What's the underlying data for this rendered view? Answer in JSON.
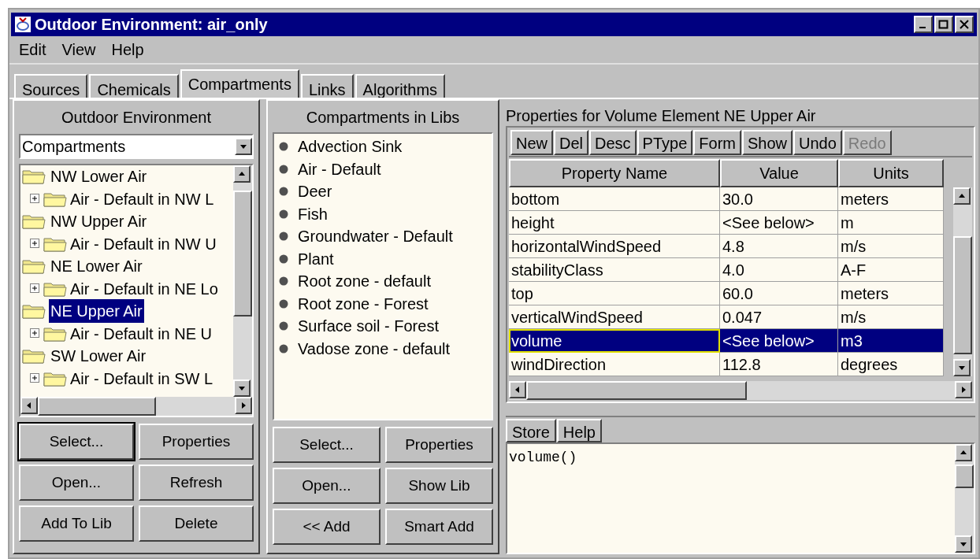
{
  "window": {
    "title": "Outdoor Environment: air_only"
  },
  "menu": [
    "Edit",
    "View",
    "Help"
  ],
  "tabs": [
    {
      "label": "Sources",
      "selected": false
    },
    {
      "label": "Chemicals",
      "selected": false
    },
    {
      "label": "Compartments",
      "selected": true
    },
    {
      "label": "Links",
      "selected": false
    },
    {
      "label": "Algorithms",
      "selected": false
    }
  ],
  "left_panel": {
    "title": "Outdoor Environment",
    "dropdown": {
      "value": "Compartments"
    },
    "tree": [
      {
        "label": "NW Lower Air",
        "selected": false,
        "children": [
          {
            "label": "Air - Default in NW L",
            "selected": false
          }
        ]
      },
      {
        "label": "NW Upper Air",
        "selected": false,
        "children": [
          {
            "label": "Air - Default in NW U",
            "selected": false
          }
        ]
      },
      {
        "label": "NE Lower Air",
        "selected": false,
        "children": [
          {
            "label": "Air - Default in NE Lo",
            "selected": false
          }
        ]
      },
      {
        "label": "NE Upper Air",
        "selected": true,
        "children": [
          {
            "label": "Air - Default in NE U",
            "selected": false
          }
        ]
      },
      {
        "label": "SW Lower Air",
        "selected": false,
        "children": [
          {
            "label": "Air - Default in SW L",
            "selected": false
          }
        ]
      }
    ],
    "buttons": [
      {
        "label": "Select...",
        "default": true
      },
      {
        "label": "Properties",
        "default": false
      },
      {
        "label": "Open...",
        "default": false
      },
      {
        "label": "Refresh",
        "default": false
      },
      {
        "label": "Add To Lib",
        "default": false
      },
      {
        "label": "Delete",
        "default": false
      }
    ]
  },
  "middle_panel": {
    "title": "Compartments in Libs",
    "items": [
      "Advection Sink",
      "Air - Default",
      "Deer",
      "Fish",
      "Groundwater - Default",
      "Plant",
      "Root zone - default",
      "Root zone - Forest",
      "Surface soil - Forest",
      "Vadose zone - default"
    ],
    "buttons": [
      "Select...",
      "Properties",
      "Open...",
      "Show Lib",
      "<< Add",
      "Smart Add"
    ]
  },
  "right_panel": {
    "title": "Properties for Volume Element NE Upper Air",
    "toolbar": [
      {
        "label": "New",
        "disabled": false
      },
      {
        "label": "Del",
        "disabled": false
      },
      {
        "label": "Desc",
        "disabled": false
      },
      {
        "label": "PType",
        "disabled": false
      },
      {
        "label": "Form",
        "disabled": false
      },
      {
        "label": "Show",
        "disabled": false
      },
      {
        "label": "Undo",
        "disabled": false
      },
      {
        "label": "Redo",
        "disabled": true
      }
    ],
    "table": {
      "columns": [
        "Property Name",
        "Value",
        "Units"
      ],
      "rows": [
        {
          "cells": [
            "bottom",
            "30.0",
            "meters"
          ],
          "selected": false
        },
        {
          "cells": [
            "height",
            "<See below>",
            "m"
          ],
          "selected": false
        },
        {
          "cells": [
            "horizontalWindSpeed",
            "4.8",
            "m/s"
          ],
          "selected": false
        },
        {
          "cells": [
            "stabilityClass",
            "4.0",
            "A-F"
          ],
          "selected": false
        },
        {
          "cells": [
            "top",
            "60.0",
            "meters"
          ],
          "selected": false
        },
        {
          "cells": [
            "verticalWindSpeed",
            "0.047",
            "m/s"
          ],
          "selected": false
        },
        {
          "cells": [
            "volume",
            "<See below>",
            "m3"
          ],
          "selected": true
        },
        {
          "cells": [
            "windDirection",
            "112.8",
            "degrees"
          ],
          "selected": false
        }
      ]
    },
    "editor_tabs": [
      "Store",
      "Help"
    ],
    "editor": {
      "value": "volume()"
    }
  }
}
